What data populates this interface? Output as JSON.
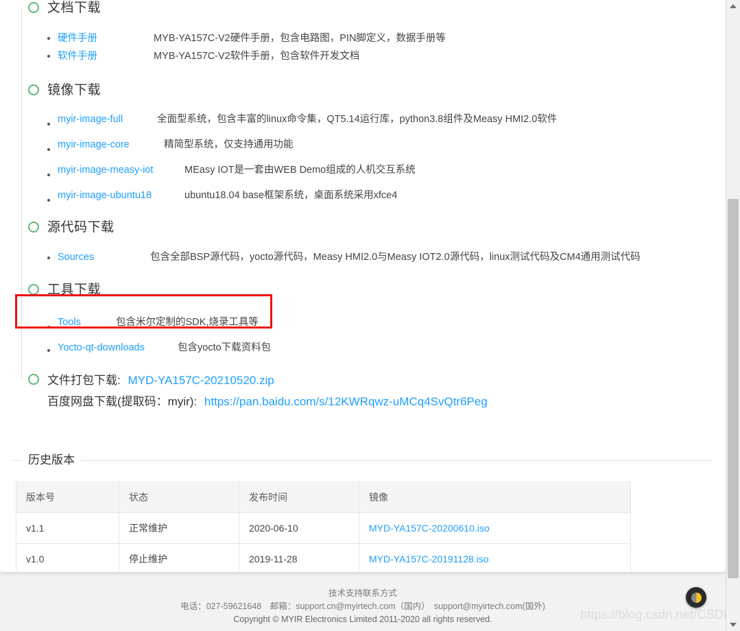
{
  "sections": [
    {
      "title": "文档下载",
      "dot": "green",
      "items": [
        {
          "name": "硬件手册",
          "desc": "MYB-YA157C-V2硬件手册，包含电路图，PIN脚定义，数据手册等"
        },
        {
          "name": "软件手册",
          "desc": "MYB-YA157C-V2软件手册，包含软件开发文档"
        }
      ]
    },
    {
      "title": "镜像下载",
      "dot": "green",
      "items": [
        {
          "name": "myir-image-full",
          "desc": "全面型系统，包含丰富的linux命令集，QT5.14运行库，python3.8组件及Measy HMI2.0软件"
        },
        {
          "name": "myir-image-core",
          "desc": "精简型系统，仅支持通用功能"
        },
        {
          "name": "myir-image-measy-iot",
          "desc": "MEasy IOT是一套由WEB Demo组成的人机交互系统"
        },
        {
          "name": "myir-image-ubuntu18",
          "desc": "ubuntu18.04 base框架系统，桌面系统采用xfce4"
        }
      ]
    },
    {
      "title": "源代码下载",
      "dot": "green",
      "items": [
        {
          "name": "Sources",
          "desc": "包含全部BSP源代码，yocto源代码，Measy HMI2.0与Measy IOT2.0源代码，linux测试代码及CM4通用测试代码"
        }
      ]
    },
    {
      "title": "工具下载",
      "dot": "green",
      "items": [
        {
          "name": "Tools",
          "desc": "包含米尔定制的SDK,烧录工具等"
        },
        {
          "name": "Yocto-qt-downloads",
          "desc": "包含yocto下载资料包"
        }
      ]
    }
  ],
  "package": {
    "dot": "green",
    "label": "文件打包下载:",
    "zip_link": "MYD-YA157C-20210520.zip",
    "baidu_label": "百度网盘下载(提取码：myir):",
    "baidu_link": "https://pan.baidu.com/s/12KWRqwz-uMCq4SvQtr6Peg"
  },
  "history": {
    "legend": "历史版本",
    "columns": [
      "版本号",
      "状态",
      "发布时间",
      "镜像"
    ],
    "rows": [
      {
        "version": "v1.1",
        "status": "正常维护",
        "date": "2020-06-10",
        "image": "MYD-YA157C-20200610.iso"
      },
      {
        "version": "v1.0",
        "status": "停止维护",
        "date": "2019-11-28",
        "image": "MYD-YA157C-20191128.iso"
      }
    ]
  },
  "footer": {
    "title": "技术支持联系方式",
    "contact": "电话：027-59621648　邮箱：support.cn@myirtech.com（国内）　support@myirtech.com(国外)",
    "copyright": "Copyright © MYIR Electronics Limited 2011-2020 all rights reserved."
  },
  "watermark": "https://blog.csdn.net/CSDN_XZ",
  "annotation": {
    "target": "Tools",
    "color": "#ee1111"
  },
  "fab": {
    "name": "theme-contrast-toggle"
  },
  "colors": {
    "link": "#1e9fff",
    "dot_green": "#5fb878",
    "header_bg": "#f5f5f5",
    "annotation_red": "#ee1111"
  }
}
